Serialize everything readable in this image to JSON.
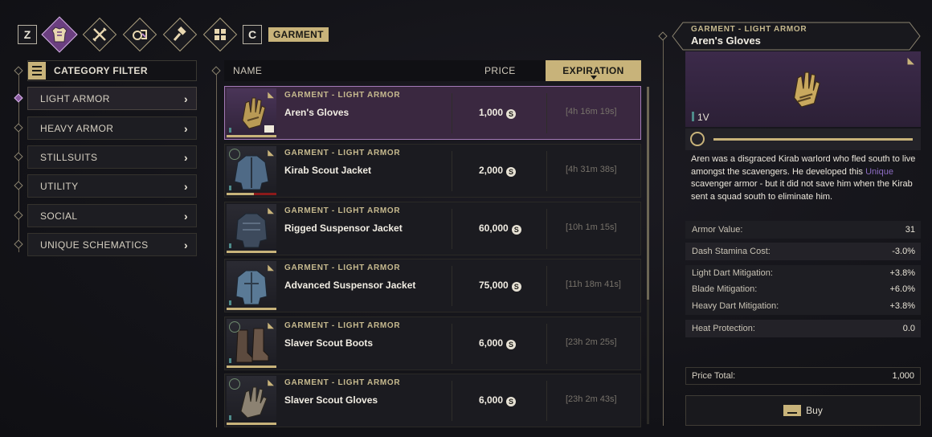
{
  "topbar": {
    "left_key": "Z",
    "right_key": "C",
    "category_label": "GARMENT",
    "tabs": [
      {
        "icon": "armor-icon",
        "active": true
      },
      {
        "icon": "crossed-weapons-icon",
        "active": false
      },
      {
        "icon": "vehicle-parts-icon",
        "active": false
      },
      {
        "icon": "hammer-icon",
        "active": false
      },
      {
        "icon": "grid-icon",
        "active": false
      }
    ]
  },
  "filter": {
    "title": "CATEGORY FILTER",
    "items": [
      {
        "label": "LIGHT ARMOR",
        "active": true
      },
      {
        "label": "HEAVY ARMOR",
        "active": false
      },
      {
        "label": "STILLSUITS",
        "active": false
      },
      {
        "label": "UTILITY",
        "active": false
      },
      {
        "label": "SOCIAL",
        "active": false
      },
      {
        "label": "UNIQUE SCHEMATICS",
        "active": false
      }
    ]
  },
  "list": {
    "columns": {
      "name": "NAME",
      "price": "PRICE",
      "expiration": "EXPIRATION"
    },
    "rows": [
      {
        "category": "GARMENT - LIGHT ARMOR",
        "name": "Aren's Gloves",
        "price": "1,000",
        "expiration": "[4h 16m 19s]",
        "selected": true,
        "thumb": "gloves"
      },
      {
        "category": "GARMENT - LIGHT ARMOR",
        "name": "Kirab Scout Jacket",
        "price": "2,000",
        "expiration": "[4h 31m 38s]",
        "selected": false,
        "thumb": "jacket"
      },
      {
        "category": "GARMENT - LIGHT ARMOR",
        "name": "Rigged Suspensor Jacket",
        "price": "60,000",
        "expiration": "[10h 1m 15s]",
        "selected": false,
        "thumb": "jacket"
      },
      {
        "category": "GARMENT - LIGHT ARMOR",
        "name": "Advanced Suspensor Jacket",
        "price": "75,000",
        "expiration": "[11h 18m 41s]",
        "selected": false,
        "thumb": "jacket"
      },
      {
        "category": "GARMENT - LIGHT ARMOR",
        "name": "Slaver Scout Boots",
        "price": "6,000",
        "expiration": "[23h 2m 25s]",
        "selected": false,
        "thumb": "boots"
      },
      {
        "category": "GARMENT - LIGHT ARMOR",
        "name": "Slaver Scout Gloves",
        "price": "6,000",
        "expiration": "[23h 2m 43s]",
        "selected": false,
        "thumb": "gloves"
      }
    ]
  },
  "detail": {
    "category": "GARMENT - LIGHT ARMOR",
    "name": "Aren's Gloves",
    "tier": "1V",
    "description_before": "Aren was a disgraced Kirab warlord who fled south to live amongst the scavengers. He developed this ",
    "description_unique": "Unique",
    "description_after": " scavenger armor - but it did not save him when the Kirab sent a squad south to eliminate him.",
    "stats": [
      {
        "label": "Armor Value:",
        "value": "31"
      },
      {
        "label": "Dash Stamina Cost:",
        "value": "-3.0%"
      },
      {
        "label": "Light Dart Mitigation:",
        "value": "+3.8%"
      },
      {
        "label": "Blade Mitigation:",
        "value": "+6.0%"
      },
      {
        "label": "Heavy Dart Mitigation:",
        "value": "+3.8%"
      },
      {
        "label": "Heat Protection:",
        "value": "0.0"
      }
    ],
    "price_total_label": "Price Total:",
    "price_total_value": "1,000",
    "buy_label": "Buy"
  },
  "colors": {
    "accent_gold": "#c8b37a",
    "selected_purple": "#3a2840",
    "unique_text": "#8c6cc2"
  }
}
